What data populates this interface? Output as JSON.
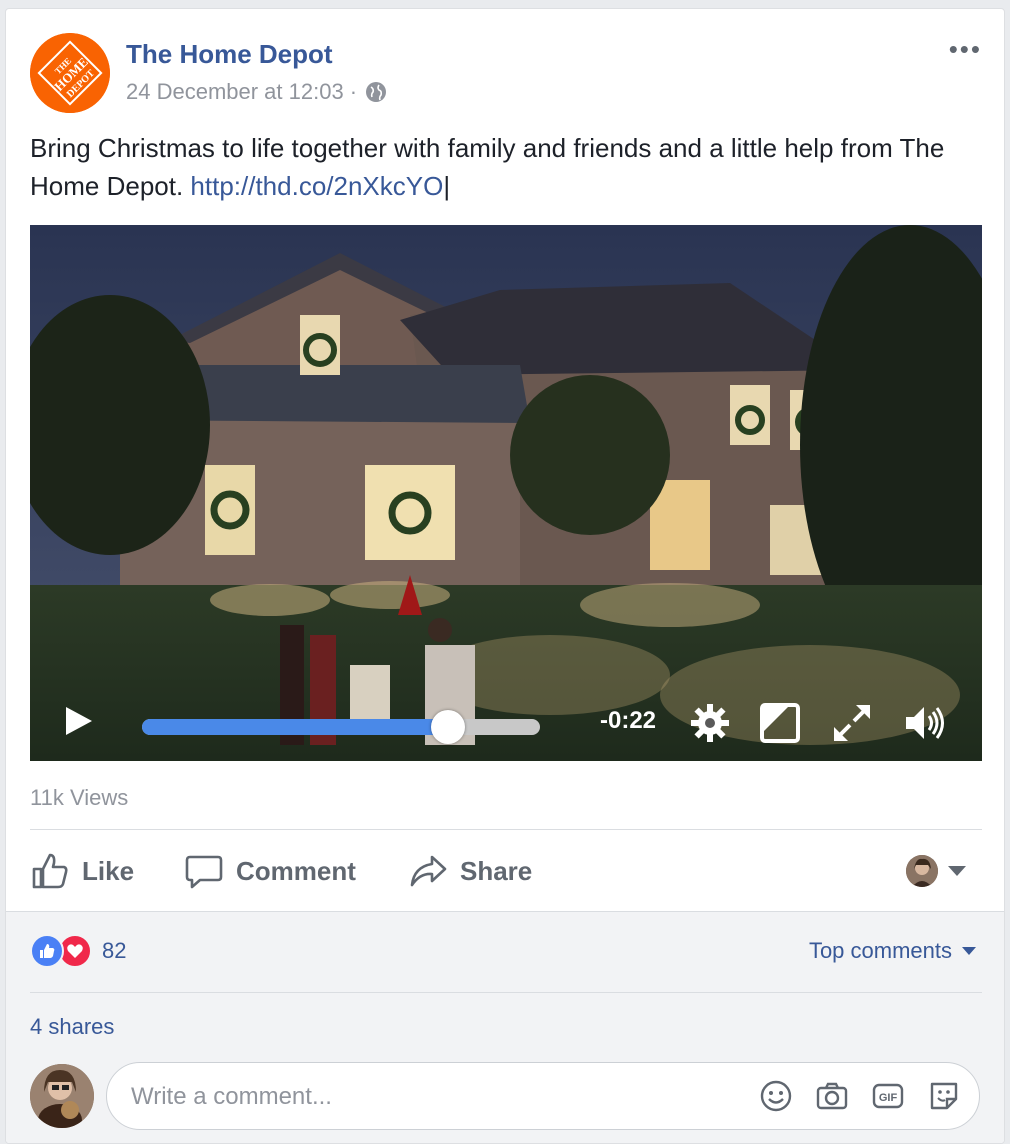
{
  "post": {
    "page_name": "The Home Depot",
    "timestamp": "24 December at 12:03 ·",
    "text_main": "Bring Christmas to life together with family and friends and a little help from The Home Depot.",
    "link": "http://thd.co/2nXkcYO",
    "logo_text": "THE HOME DEPOT"
  },
  "video": {
    "time_remaining": "-0:22",
    "progress": 0.77,
    "icons": [
      "play-icon",
      "settings-gear-icon",
      "picture-in-picture-icon",
      "fullscreen-icon",
      "volume-icon"
    ]
  },
  "stats": {
    "views": "11k Views",
    "reaction_count": "82",
    "shares": "4 shares",
    "top_comments": "Top comments"
  },
  "actions": {
    "like": "Like",
    "comment": "Comment",
    "share": "Share"
  },
  "comment_box": {
    "placeholder": "Write a comment...",
    "icons": [
      "emoji-icon",
      "camera-icon",
      "gif-icon",
      "sticker-icon"
    ]
  },
  "colors": {
    "link": "#385898",
    "brand_orange": "#f96302",
    "progress_blue": "#4a89e8",
    "like_blue": "#4a80f5",
    "love_red": "#f0284a"
  }
}
